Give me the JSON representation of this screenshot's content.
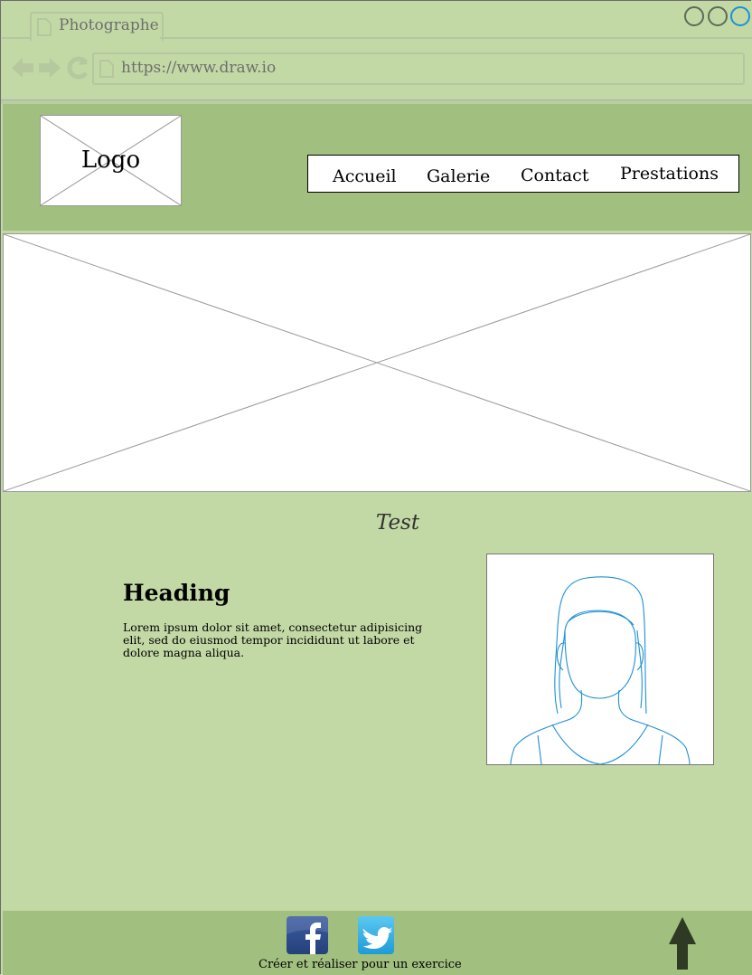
{
  "browser": {
    "tab_title": "Photographe",
    "url": "https://www.draw.io"
  },
  "header": {
    "logo_label": "Logo",
    "nav": [
      "Accueil",
      "Galerie",
      "Contact",
      "Prestations"
    ]
  },
  "content": {
    "section_title": "Test",
    "heading": "Heading",
    "body": "Lorem ipsum dolor sit amet, consectetur adipisicing elit, sed do eiusmod tempor incididunt ut labore et dolore magna aliqua."
  },
  "footer": {
    "text": "Créer et réaliser pour un exercice",
    "social_icons": [
      "facebook-icon",
      "twitter-icon"
    ]
  },
  "colors": {
    "page_background": "#c3d9a5",
    "header_footer": "#a1bf7f",
    "portrait_stroke": "#1e90d6",
    "arrow": "#2f3a24"
  }
}
